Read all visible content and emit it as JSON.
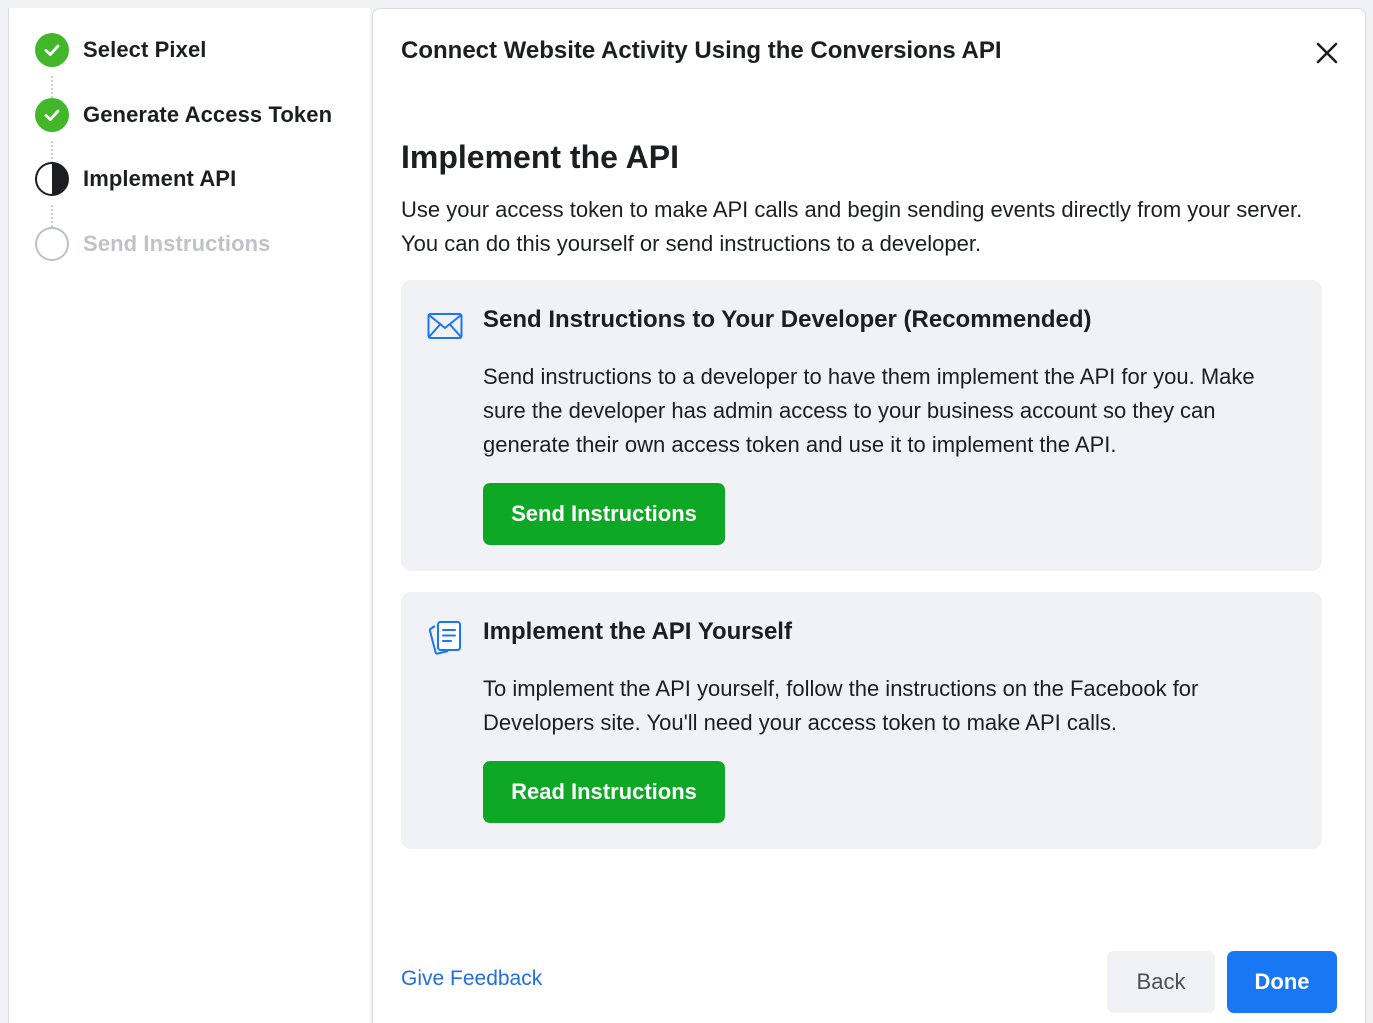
{
  "colors": {
    "success_green": "#42b72a",
    "button_green": "#0fa826",
    "primary_blue": "#1877f2",
    "link_blue": "#216fdb",
    "card_gray": "#f0f2f5",
    "text_dark": "#1c1e21",
    "text_muted": "#bec3c9"
  },
  "stepper": {
    "steps": [
      {
        "label": "Select Pixel",
        "status": "complete",
        "icon": "check-circle-icon"
      },
      {
        "label": "Generate Access Token",
        "status": "complete",
        "icon": "check-circle-icon"
      },
      {
        "label": "Implement API",
        "status": "in-progress",
        "icon": "half-circle-icon"
      },
      {
        "label": "Send Instructions",
        "status": "pending",
        "icon": "empty-circle-icon"
      }
    ]
  },
  "dialog": {
    "title": "Connect Website Activity Using the Conversions API",
    "close_icon": "close-icon",
    "section_title": "Implement the API",
    "section_description": "Use your access token to make API calls and begin sending events directly from your server. You can do this yourself or send instructions to a developer.",
    "cards": [
      {
        "icon": "envelope-icon",
        "title": "Send Instructions to Your Developer (Recommended)",
        "body": "Send instructions to a developer to have them implement the API for you. Make sure the developer has admin access to your business account so they can generate their own access token and use it to implement the API.",
        "button_label": "Send Instructions"
      },
      {
        "icon": "document-stack-icon",
        "title": "Implement the API Yourself",
        "body": "To implement the API yourself, follow the instructions on the Facebook for Developers site. You'll need your access token to make API calls.",
        "button_label": "Read Instructions"
      }
    ],
    "footer": {
      "feedback_link": "Give Feedback",
      "back_label": "Back",
      "done_label": "Done"
    }
  }
}
